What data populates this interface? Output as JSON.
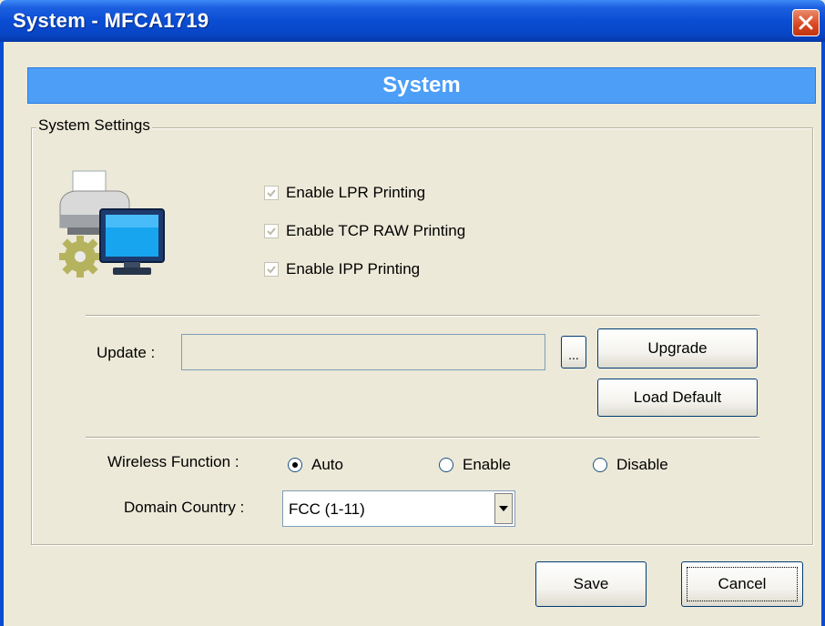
{
  "window": {
    "title": "System - MFCA1719"
  },
  "header": {
    "title": "System"
  },
  "group": {
    "legend": "System Settings"
  },
  "checkboxes": [
    {
      "label": "Enable LPR Printing",
      "checked": true,
      "enabled": false
    },
    {
      "label": "Enable TCP RAW Printing",
      "checked": true,
      "enabled": false
    },
    {
      "label": "Enable IPP Printing",
      "checked": true,
      "enabled": false
    }
  ],
  "update": {
    "label": "Update :",
    "value": "",
    "browse_label": "...",
    "upgrade_label": "Upgrade",
    "load_default_label": "Load Default"
  },
  "wireless": {
    "label": "Wireless Function :",
    "options": [
      {
        "label": "Auto",
        "selected": true
      },
      {
        "label": "Enable",
        "selected": false
      },
      {
        "label": "Disable",
        "selected": false
      }
    ]
  },
  "domain": {
    "label": "Domain Country :",
    "selected": "FCC (1-11)"
  },
  "footer": {
    "save_label": "Save",
    "cancel_label": "Cancel"
  },
  "colors": {
    "titlebar": "#0a4dd3",
    "header_band": "#4c9ef7",
    "dialog_bg": "#ece9d8",
    "close_button": "#d8451e"
  },
  "icons": [
    "close-icon",
    "printer-computer-icon",
    "checkmark-icon",
    "dropdown-arrow-icon"
  ]
}
